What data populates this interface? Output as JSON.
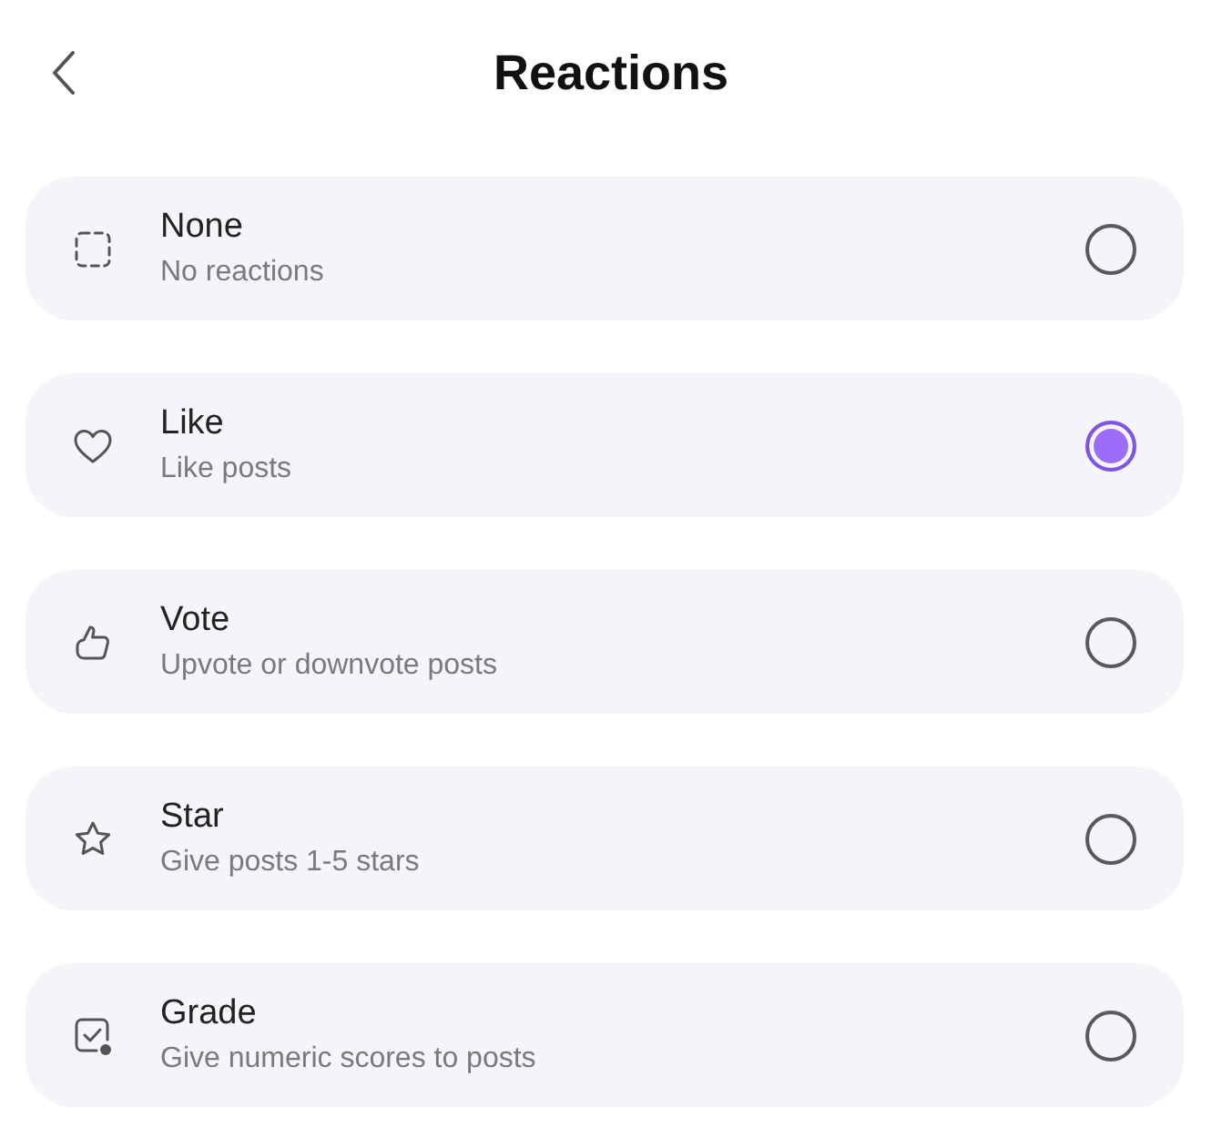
{
  "header": {
    "title": "Reactions"
  },
  "options": [
    {
      "kind": "none",
      "title": "None",
      "description": "No reactions",
      "selected": false
    },
    {
      "kind": "like",
      "title": "Like",
      "description": "Like posts",
      "selected": true
    },
    {
      "kind": "vote",
      "title": "Vote",
      "description": "Upvote or downvote posts",
      "selected": false
    },
    {
      "kind": "star",
      "title": "Star",
      "description": "Give posts 1-5 stars",
      "selected": false
    },
    {
      "kind": "grade",
      "title": "Grade",
      "description": "Give numeric scores to posts",
      "selected": false
    }
  ]
}
